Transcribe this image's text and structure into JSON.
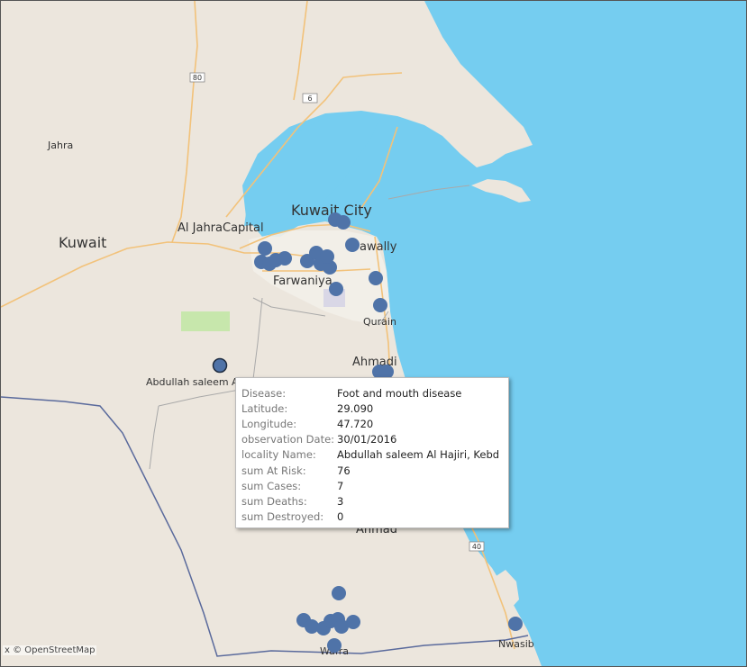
{
  "map": {
    "attribution": "x © OpenStreetMap",
    "colors": {
      "land": "#ece6dd",
      "water": "#75cdf0",
      "road": "#f2c27a",
      "border": "#5a6a9c",
      "marker": "#4f73a8",
      "park": "#c7e7ac"
    },
    "labels": {
      "kuwait": "Kuwait",
      "jahra": "Jahra",
      "al_jahra": "Al Jahra",
      "capital": "Capital",
      "kuwait_city": "Kuwait City",
      "hawally": "awally",
      "farwaniya": "Farwaniya",
      "qurain": "Qurain",
      "ahmadi": "Ahmadi",
      "ahmad": "Ahmad",
      "nwasib": "Nwasib",
      "wafra": "Wafra",
      "selected_locality": "Abdullah saleem A"
    },
    "road_shields": [
      "80",
      "6",
      "40"
    ]
  },
  "tooltip": {
    "rows": [
      {
        "key": "Disease:",
        "value": "Foot and mouth disease"
      },
      {
        "key": "Latitude:",
        "value": "29.090"
      },
      {
        "key": "Longitude:",
        "value": "47.720"
      },
      {
        "key": "observation Date:",
        "value": "30/01/2016"
      },
      {
        "key": "locality Name:",
        "value": "Abdullah saleem Al Hajiri, Kebd"
      },
      {
        "key": "sum At Risk:",
        "value": "76"
      },
      {
        "key": "sum Cases:",
        "value": "7"
      },
      {
        "key": "sum Deaths:",
        "value": "3"
      },
      {
        "key": "sum Destroyed:",
        "value": "0"
      }
    ]
  }
}
